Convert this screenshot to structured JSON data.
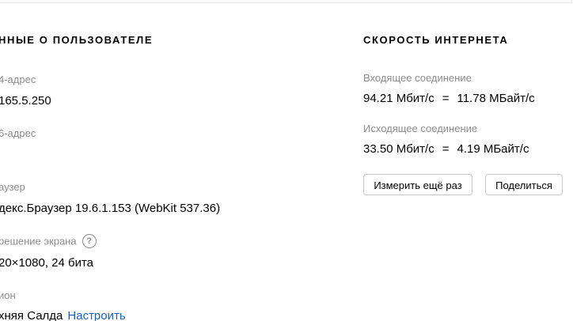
{
  "user_info": {
    "title": "нные о пользователе",
    "ipv4_label": "4-адрес",
    "ipv4_value": "165.5.250",
    "ipv6_label": "6-адрес",
    "ipv6_value": "",
    "browser_label": "аузер",
    "browser_value": "декс.Браузер 19.6.1.153 (WebKit 537.36)",
    "resolution_label": "решение экрана",
    "resolution_help": "?",
    "resolution_value": "20×1080, 24 бита",
    "region_label": "ион",
    "region_value": "хняя Салда",
    "region_link": "Настроить"
  },
  "speed": {
    "title": "Скорость интернета",
    "download_label": "Входящее соединение",
    "download_mbit": "94.21 Мбит/с",
    "download_eq": "=",
    "download_mbyte": "11.78 МБайт/с",
    "upload_label": "Исходящее соединение",
    "upload_mbit": "33.50 Мбит/с",
    "upload_eq": "=",
    "upload_mbyte": "4.19 МБайт/с",
    "measure_again_button": "Измерить ещё раз",
    "share_button": "Поделиться"
  },
  "icons": {
    "help": "question-circle-icon"
  }
}
